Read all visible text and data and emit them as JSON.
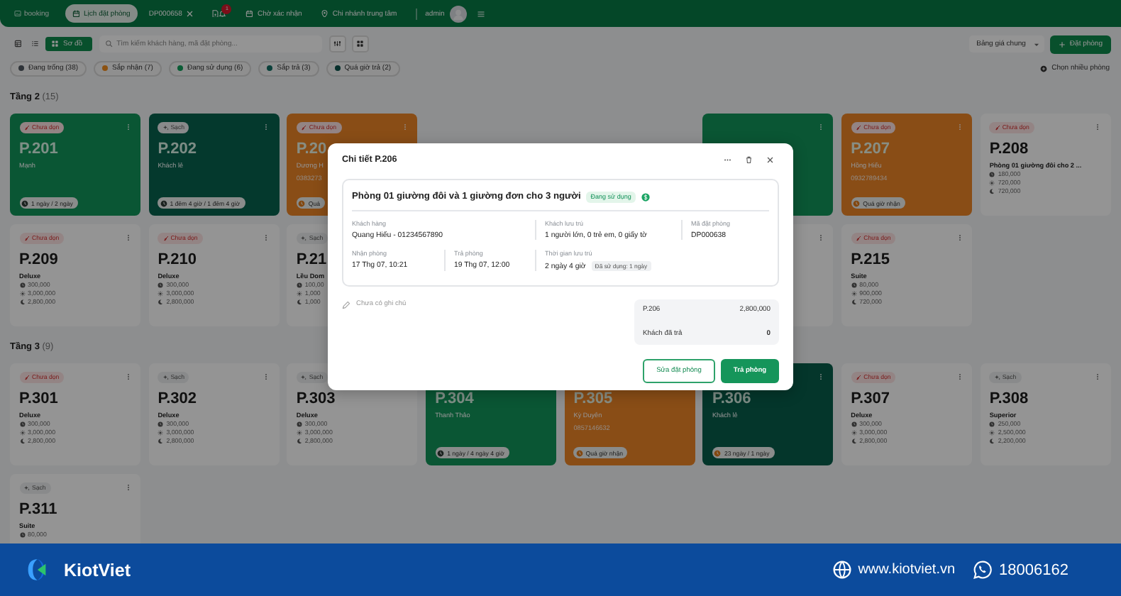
{
  "header": {
    "logo": "booking",
    "tabs": [
      {
        "label": "Lịch đặt phòng",
        "kind": "calendar",
        "selected": true
      },
      {
        "label": "DP000658",
        "kind": "booking",
        "selected": false
      }
    ],
    "notifications": "1",
    "pending": "Chờ xác nhận",
    "branch": "Chi nhánh trung tâm",
    "user": "admin"
  },
  "toolbar": {
    "views": [
      {
        "kind": "table",
        "selected": false
      },
      {
        "kind": "list",
        "selected": false
      },
      {
        "kind": "map",
        "label": "Sơ đồ",
        "selected": true
      }
    ],
    "search": {
      "placeholder": "Tìm kiếm khách hàng, mã đặt phòng..."
    },
    "price_list": "Bảng giá chung",
    "book_button": "Đặt phòng"
  },
  "filters": [
    {
      "label": "Đang trống (38)",
      "color": "#2e3338"
    },
    {
      "label": "Sắp nhận (7)",
      "color": "#8c5212"
    },
    {
      "label": "Đang sử dụng (6)",
      "color": "#0a5c35"
    },
    {
      "label": "Sắp trả (3)",
      "color": "#0a403a"
    },
    {
      "label": "Quá giờ trả (2)",
      "color": "#07302c"
    }
  ],
  "select_multiple": "Chọn nhiều phòng",
  "floors": [
    {
      "name": "Tầng 2",
      "count": "(15)",
      "rooms": [
        {
          "kind": "in_use",
          "tag": {
            "label": "Chưa dọn",
            "kind": "dirty"
          },
          "number": "P.201",
          "guest": "Mạnh",
          "badge": {
            "text": "1 ngày / 2 ngày",
            "warn": false
          }
        },
        {
          "kind": "leaving",
          "tag": {
            "label": "Sạch",
            "kind": "clean"
          },
          "number": "P.202",
          "guest": "Khách lẻ",
          "badge": {
            "text": "1 đêm 4 giờ / 1 đêm 4 giờ",
            "warn": false
          }
        },
        {
          "kind": "arriving",
          "tag": {
            "label": "Chưa dọn",
            "kind": "dirty"
          },
          "number": "P.20",
          "guest": "Dương H",
          "phone": "0383273",
          "badge": {
            "text": "Quá",
            "warn": true
          }
        },
        {
          "kind": "covered"
        },
        {
          "kind": "covered"
        },
        {
          "kind": "in_use"
        },
        {
          "kind": "arriving",
          "tag": {
            "label": "Chưa dọn",
            "kind": "dirty"
          },
          "number": "P.207",
          "guest": "Hồng Hiếu",
          "phone": "0932789434",
          "badge": {
            "text": "Quá giờ nhận",
            "warn": true
          }
        },
        {
          "kind": "vacant",
          "tag": {
            "label": "Chưa dọn",
            "kind": "dirty"
          },
          "number": "P.208",
          "type": "Phòng 01 giường đôi cho 2 ...",
          "prices": [
            "180,000",
            "720,000",
            "720,000"
          ]
        },
        {
          "kind": "vacant",
          "tag": {
            "label": "Chưa dọn",
            "kind": "dirty"
          },
          "number": "P.209",
          "type": "Deluxe",
          "prices": [
            "300,000",
            "3,000,000",
            "2,800,000"
          ]
        },
        {
          "kind": "vacant",
          "tag": {
            "label": "Chưa dọn",
            "kind": "dirty"
          },
          "number": "P.210",
          "type": "Deluxe",
          "prices": [
            "300,000",
            "3,000,000",
            "2,800,000"
          ]
        },
        {
          "kind": "vacant",
          "tag": {
            "label": "Sạch",
            "kind": "clean"
          },
          "number": "P.21",
          "type": "Lều Dom",
          "prices": [
            "100,00",
            "1,000",
            "1,000"
          ]
        },
        {
          "kind": "covered"
        },
        {
          "kind": "covered"
        },
        {
          "kind": "vacant"
        },
        {
          "kind": "vacant",
          "tag": {
            "label": "Chưa dọn",
            "kind": "dirty"
          },
          "number": "P.215",
          "type": "Suite",
          "prices": [
            "80,000",
            "900,000",
            "720,000"
          ]
        }
      ]
    },
    {
      "name": "Tầng 3",
      "count": "(9)",
      "rooms": [
        {
          "kind": "vacant",
          "tag": {
            "label": "Chưa dọn",
            "kind": "dirty"
          },
          "number": "P.301",
          "type": "Deluxe",
          "prices": [
            "300,000",
            "3,000,000",
            "2,800,000"
          ]
        },
        {
          "kind": "vacant",
          "tag": {
            "label": "Sạch",
            "kind": "clean"
          },
          "number": "P.302",
          "type": "Deluxe",
          "prices": [
            "300,000",
            "3,000,000",
            "2,800,000"
          ]
        },
        {
          "kind": "vacant",
          "tag": {
            "label": "Sạch",
            "kind": "clean"
          },
          "number": "P.303",
          "type": "Deluxe",
          "prices": [
            "300,000",
            "3,000,000",
            "2,800,000"
          ]
        },
        {
          "kind": "in_use",
          "number": "P.304",
          "guest": "Thanh Thảo",
          "badge": {
            "text": "1 ngày / 4 ngày 4 giờ",
            "warn": false
          }
        },
        {
          "kind": "arriving",
          "number": "P.305",
          "guest": "Kỳ Duyên",
          "phone": "0857146632",
          "badge": {
            "text": "Quá giờ nhận",
            "warn": true
          }
        },
        {
          "kind": "overdue",
          "number": "P.306",
          "guest": "Khách lẻ",
          "badge": {
            "text": "23 ngày / 1 ngày",
            "warn": true
          }
        },
        {
          "kind": "vacant",
          "tag": {
            "label": "Chưa dọn",
            "kind": "dirty"
          },
          "number": "P.307",
          "type": "Deluxe",
          "prices": [
            "300,000",
            "3,000,000",
            "2,800,000"
          ]
        },
        {
          "kind": "vacant",
          "tag": {
            "label": "Sạch",
            "kind": "clean"
          },
          "number": "P.308",
          "type": "Superior",
          "prices": [
            "250,000",
            "2,500,000",
            "2,200,000"
          ]
        },
        {
          "kind": "vacant",
          "tag": {
            "label": "Sạch",
            "kind": "clean"
          },
          "number": "P.311",
          "type": "Suite",
          "prices": [
            "80,000"
          ]
        }
      ]
    }
  ],
  "modal": {
    "title": "Chi tiết P.206",
    "room_type": "Phòng 01 giường đôi và 1 giường đơn cho 3 người",
    "status": "Đang sử dụng",
    "fields": [
      {
        "label": "Khách hàng",
        "value": "Quang Hiếu - 01234567890"
      },
      {
        "label": "Khách lưu trú",
        "value": "1 người lớn, 0 trẻ em, 0 giấy tờ"
      },
      {
        "label": "Mã đặt phòng",
        "value": "DP000638"
      },
      {
        "label": "Nhận phòng",
        "value": "17 Thg 07, 10:21"
      },
      {
        "label": "Trả phòng",
        "value": "19 Thg 07, 12:00"
      },
      {
        "label": "Thời gian lưu trú",
        "value": "2 ngày 4 giờ",
        "note": "Đã sử dụng: 1 ngày"
      }
    ],
    "note": "Chưa có ghi chú",
    "summary": [
      {
        "label": "P.206",
        "value": "2,800,000"
      },
      {
        "label": "Khách đã trả",
        "value": "0"
      }
    ],
    "buttons": [
      {
        "label": "Sửa đặt phòng",
        "kind": "outline"
      },
      {
        "label": "Trả phòng",
        "kind": "primary"
      }
    ]
  },
  "footer": {
    "brand": "KiotViet",
    "website": "www.kiotviet.vn",
    "phone": "18006162"
  }
}
